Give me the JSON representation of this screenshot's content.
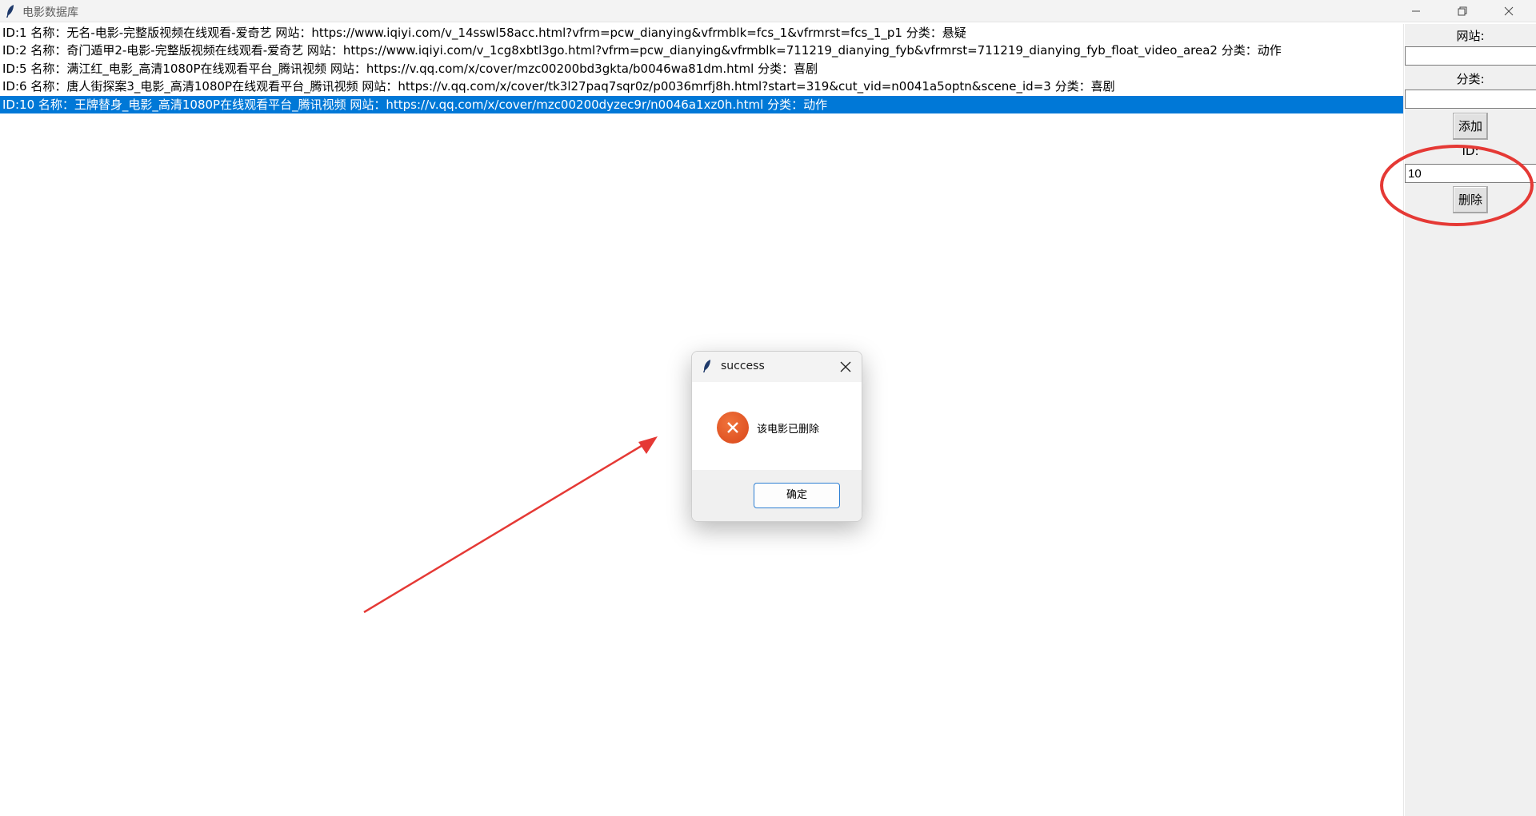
{
  "window": {
    "title": "电影数据库"
  },
  "movies": [
    {
      "text": "ID:1  名称：无名-电影-完整版视频在线观看-爱奇艺  网站：https://www.iqiyi.com/v_14sswl58acc.html?vfrm=pcw_dianying&vfrmblk=fcs_1&vfrmrst=fcs_1_p1  分类：悬疑",
      "selected": false
    },
    {
      "text": "ID:2  名称：奇门遁甲2-电影-完整版视频在线观看-爱奇艺  网站：https://www.iqiyi.com/v_1cg8xbtl3go.html?vfrm=pcw_dianying&vfrmblk=711219_dianying_fyb&vfrmrst=711219_dianying_fyb_float_video_area2  分类：动作",
      "selected": false
    },
    {
      "text": "ID:5  名称：满江红_电影_高清1080P在线观看平台_腾讯视频  网站：https://v.qq.com/x/cover/mzc00200bd3gkta/b0046wa81dm.html  分类：喜剧",
      "selected": false
    },
    {
      "text": "ID:6  名称：唐人街探案3_电影_高清1080P在线观看平台_腾讯视频  网站：https://v.qq.com/x/cover/tk3l27paq7sqr0z/p0036mrfj8h.html?start=319&cut_vid=n0041a5optn&scene_id=3  分类：喜剧",
      "selected": false
    },
    {
      "text": "ID:10  名称：王牌替身_电影_高清1080P在线观看平台_腾讯视频  网站：https://v.qq.com/x/cover/mzc00200dyzec9r/n0046a1xz0h.html  分类：动作",
      "selected": true
    }
  ],
  "panel": {
    "site_label": "网站:",
    "site_value": "",
    "category_label": "分类:",
    "category_value": "",
    "add_button": "添加",
    "id_label": "ID:",
    "id_value": "10",
    "delete_button": "删除"
  },
  "dialog": {
    "title": "success",
    "message": "该电影已删除",
    "ok_button": "确定",
    "icon": "error-x-icon"
  },
  "colors": {
    "selection": "#0078d7",
    "annotation": "#e53935",
    "error_icon": "#e0522a"
  }
}
